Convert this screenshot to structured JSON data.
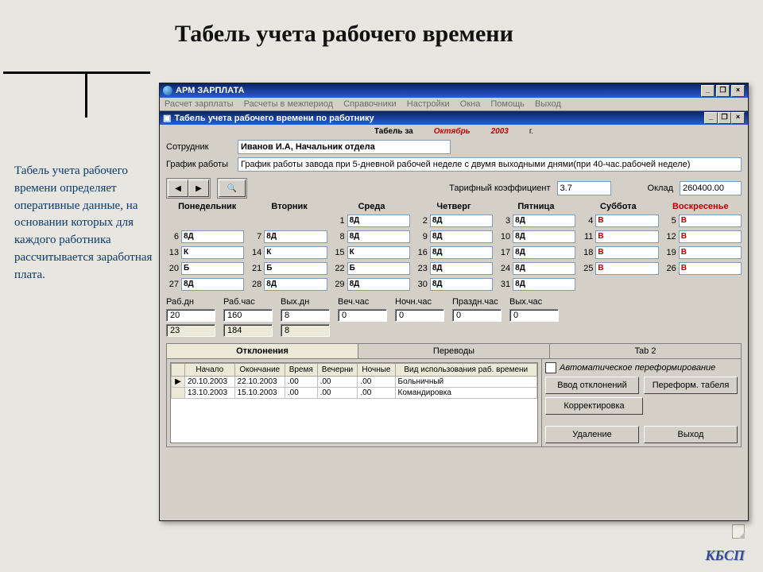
{
  "slide": {
    "title": "Табель учета рабочего времени",
    "sidebar_text": "Табель учета рабочего времени определяет оперативные данные, на основании которых для каждого работника рассчитывается заработная плата.",
    "footer": "КБСП"
  },
  "app": {
    "title": "АРМ ЗАРПЛАТА",
    "menu": [
      "Расчет зарплаты",
      "Расчеты в межпериод",
      "Справочники",
      "Настройки",
      "Окна",
      "Помощь",
      "Выход"
    ],
    "subwindow_title": "Табель учета рабочего времени по работнику",
    "period_label": "Табель за",
    "month": "Октябрь",
    "year": "2003",
    "year_suffix": "г.",
    "employee_label": "Сотрудник",
    "employee": "Иванов И.А,   Начальник отдела",
    "schedule_label": "График работы",
    "schedule": "График работы завода при 5-дневной рабочей неделе с двумя выходными днями(при 40-час.рабочей неделе)",
    "coeff_label": "Тарифный коэффициент",
    "coeff": "3.7",
    "salary_label": "Оклад",
    "salary": "260400.00",
    "days": [
      "Понедельник",
      "Вторник",
      "Среда",
      "Четверг",
      "Пятница",
      "Суббота",
      "Воскресенье"
    ],
    "calendar": [
      {
        "n": "",
        "v": "",
        "cls": "empty"
      },
      {
        "n": "",
        "v": "",
        "cls": "empty"
      },
      {
        "n": "1",
        "v": "8Д"
      },
      {
        "n": "2",
        "v": "8Д"
      },
      {
        "n": "3",
        "v": "8Д"
      },
      {
        "n": "4",
        "v": "В",
        "red": true
      },
      {
        "n": "5",
        "v": "В",
        "red": true
      },
      {
        "n": "6",
        "v": "8Д"
      },
      {
        "n": "7",
        "v": "8Д"
      },
      {
        "n": "8",
        "v": "8Д"
      },
      {
        "n": "9",
        "v": "8Д"
      },
      {
        "n": "10",
        "v": "8Д"
      },
      {
        "n": "11",
        "v": "В",
        "red": true
      },
      {
        "n": "12",
        "v": "В",
        "red": true
      },
      {
        "n": "13",
        "v": "К"
      },
      {
        "n": "14",
        "v": "К"
      },
      {
        "n": "15",
        "v": "К"
      },
      {
        "n": "16",
        "v": "8Д"
      },
      {
        "n": "17",
        "v": "8Д"
      },
      {
        "n": "18",
        "v": "В",
        "red": true
      },
      {
        "n": "19",
        "v": "В",
        "red": true
      },
      {
        "n": "20",
        "v": "Б"
      },
      {
        "n": "21",
        "v": "Б"
      },
      {
        "n": "22",
        "v": "Б"
      },
      {
        "n": "23",
        "v": "8Д"
      },
      {
        "n": "24",
        "v": "8Д"
      },
      {
        "n": "25",
        "v": "В",
        "red": true
      },
      {
        "n": "26",
        "v": "В",
        "red": true
      },
      {
        "n": "27",
        "v": "8Д"
      },
      {
        "n": "28",
        "v": "8Д"
      },
      {
        "n": "29",
        "v": "8Д"
      },
      {
        "n": "30",
        "v": "8Д"
      },
      {
        "n": "31",
        "v": "8Д"
      },
      {
        "n": "",
        "v": "",
        "cls": "empty"
      },
      {
        "n": "",
        "v": "",
        "cls": "empty"
      }
    ],
    "totals_labels": [
      "Раб.дн",
      "Раб.час",
      "Вых.дн",
      "Веч.час",
      "Ночн.час",
      "Праздн.час",
      "Вых.час"
    ],
    "totals_row1": [
      "20",
      "160",
      "8",
      "0",
      "0",
      "0",
      "0"
    ],
    "totals_row2": [
      "23",
      "184",
      "8",
      "",
      "",
      "",
      ""
    ],
    "tabs": [
      "Отклонения",
      "Переводы",
      "Tab 2"
    ],
    "grid_headers": [
      "",
      "Начало",
      "Окончание",
      "Время",
      "Вечерни",
      "Ночные",
      "Вид использования раб. времени"
    ],
    "grid_rows": [
      {
        "mark": "▶",
        "c": [
          "20.10.2003",
          "22.10.2003",
          ".00",
          ".00",
          ".00",
          "Больничный"
        ]
      },
      {
        "mark": "",
        "c": [
          "13.10.2003",
          "15.10.2003",
          ".00",
          ".00",
          ".00",
          "Командировка"
        ]
      }
    ],
    "auto_reform": "Автоматическое переформирование",
    "btn_input": "Ввод отклонений",
    "btn_reform": "Переформ. табеля",
    "btn_correct": "Корректировка",
    "btn_delete": "Удаление",
    "btn_exit": "Выход"
  }
}
